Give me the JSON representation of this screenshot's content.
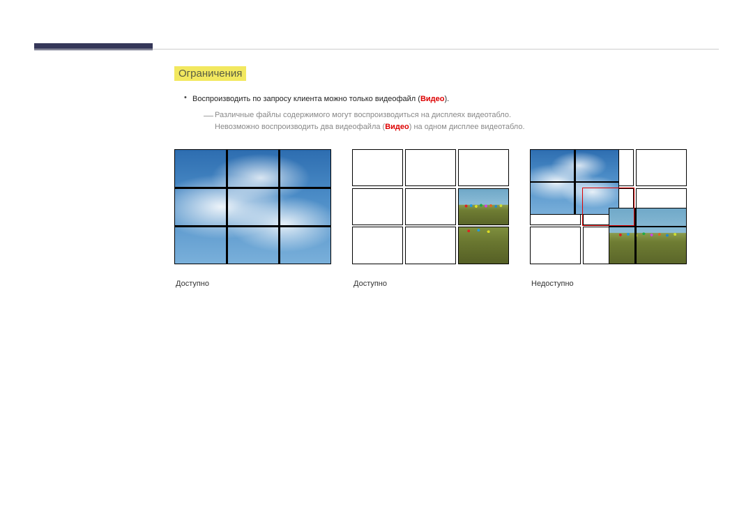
{
  "section_title": "Ограничения",
  "bullet": {
    "prefix": "Воспроизводить по запросу клиента можно только видеофайл (",
    "video_word": "Видео",
    "suffix": ")."
  },
  "sub": {
    "line1": "Различные файлы содержимого могут воспроизводиться на дисплеях видеотабло.",
    "line2_prefix": "Невозможно воспроизводить два видеофайла (",
    "line2_video": "Видео",
    "line2_suffix": ") на одном дисплее видеотабло."
  },
  "captions": {
    "fig1": "Доступно",
    "fig2": "Доступно",
    "fig3": "Недоступно"
  }
}
